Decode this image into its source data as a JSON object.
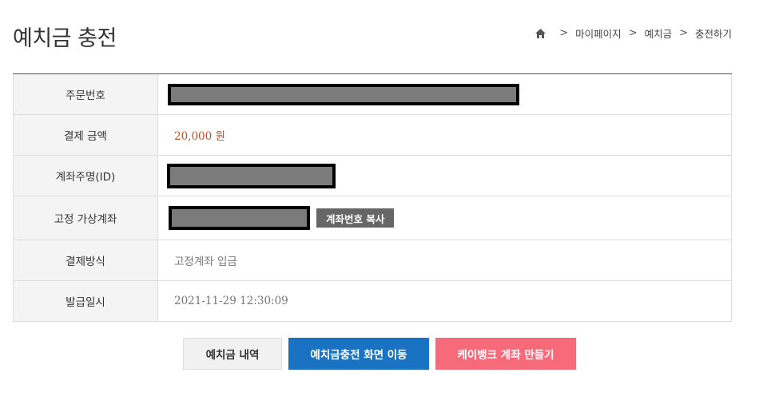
{
  "page": {
    "title": "예치금 충전"
  },
  "breadcrumb": {
    "items": [
      "마이페이지",
      "예치금",
      "충전하기"
    ],
    "separator": ">"
  },
  "table": {
    "rows": [
      {
        "label": "주문번호",
        "value": ""
      },
      {
        "label": "결제 금액",
        "value": "20,000 원"
      },
      {
        "label": "계좌주명(ID)",
        "value": ""
      },
      {
        "label": "고정 가상계좌",
        "value": "",
        "button": "계좌번호 복사"
      },
      {
        "label": "결제방식",
        "value": "고정계좌 입금"
      },
      {
        "label": "발급일시",
        "value": "2021-11-29 12:30:09"
      }
    ]
  },
  "actions": {
    "history": "예치금 내역",
    "charge": "예치금충전 화면 이동",
    "kbank": "케이뱅크 계좌 만들기"
  },
  "colors": {
    "amount": "#c0502b",
    "charge_button": "#1a73c2",
    "kbank_button": "#f76a7a",
    "copy_button": "#666666",
    "redaction": "#7b7b7b"
  }
}
